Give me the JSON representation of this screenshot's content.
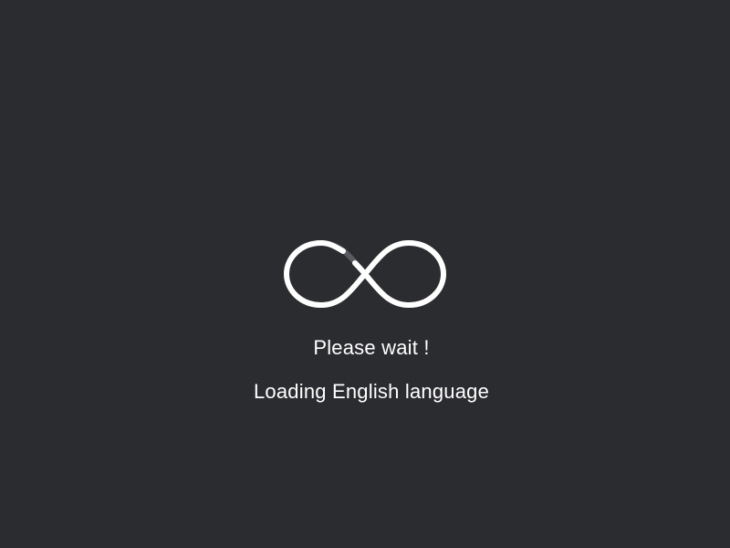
{
  "loader": {
    "icon": "infinity-loader-icon",
    "colors": {
      "background": "#2b2c30",
      "stroke": "#ffffff",
      "stroke_shadow": "#5a5b60"
    }
  },
  "messages": {
    "wait": "Please wait !",
    "loading": "Loading English language"
  }
}
